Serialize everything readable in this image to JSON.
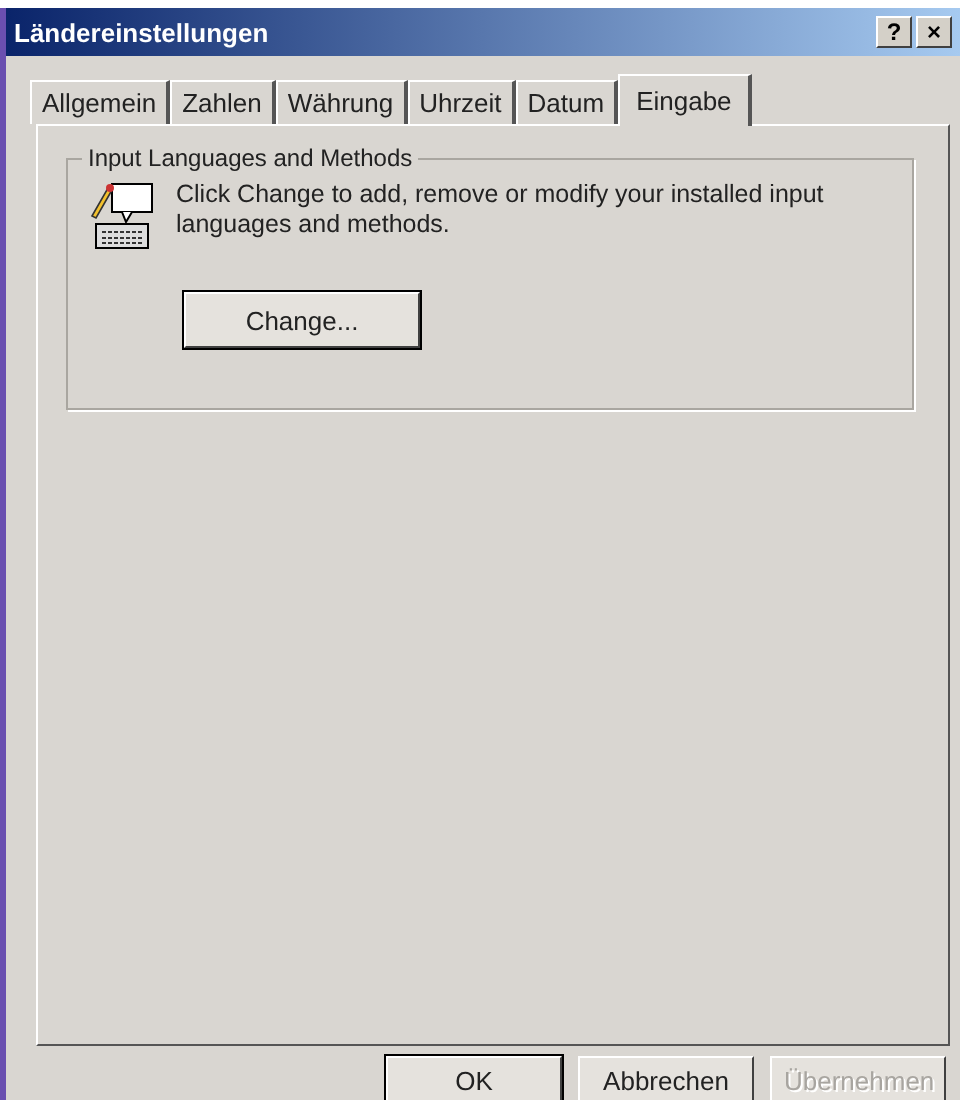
{
  "window": {
    "title": "Ländereinstellungen",
    "title_buttons": [
      "?",
      "×"
    ]
  },
  "tabs": [
    {
      "label": "Allgemein",
      "selected": false
    },
    {
      "label": "Zahlen",
      "selected": false
    },
    {
      "label": "Währung",
      "selected": false
    },
    {
      "label": "Uhrzeit",
      "selected": false
    },
    {
      "label": "Datum",
      "selected": false
    },
    {
      "label": "Eingabe",
      "selected": true
    }
  ],
  "group": {
    "title": "Input Languages and Methods",
    "description": "Click Change to add, remove or modify your installed input languages and methods.",
    "button": "Change..."
  },
  "buttons": [
    {
      "label": "OK",
      "disabled": false,
      "default": true
    },
    {
      "label": "Abbrechen",
      "disabled": false,
      "default": false
    },
    {
      "label": "Übernehmen",
      "disabled": true,
      "default": false
    }
  ]
}
